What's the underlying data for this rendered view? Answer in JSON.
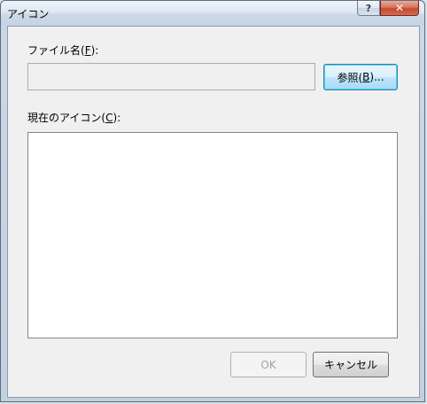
{
  "window": {
    "title": "アイコン",
    "help_glyph": "?",
    "close_glyph": "✕"
  },
  "filename": {
    "label_prefix": "ファイル名(",
    "label_accel": "F",
    "label_suffix": "):",
    "value": ""
  },
  "browse": {
    "label_prefix": "参照(",
    "label_accel": "B",
    "label_suffix": ")..."
  },
  "current_icon": {
    "label_prefix": "現在のアイコン(",
    "label_accel": "C",
    "label_suffix": "):",
    "items": []
  },
  "buttons": {
    "ok": "OK",
    "cancel": "キャンセル"
  },
  "colors": {
    "client_bg": "#f0f0f0",
    "focus_button_border": "#3c7fb1",
    "disabled_text": "#a0a0a0",
    "close_button": "#c34a31"
  }
}
